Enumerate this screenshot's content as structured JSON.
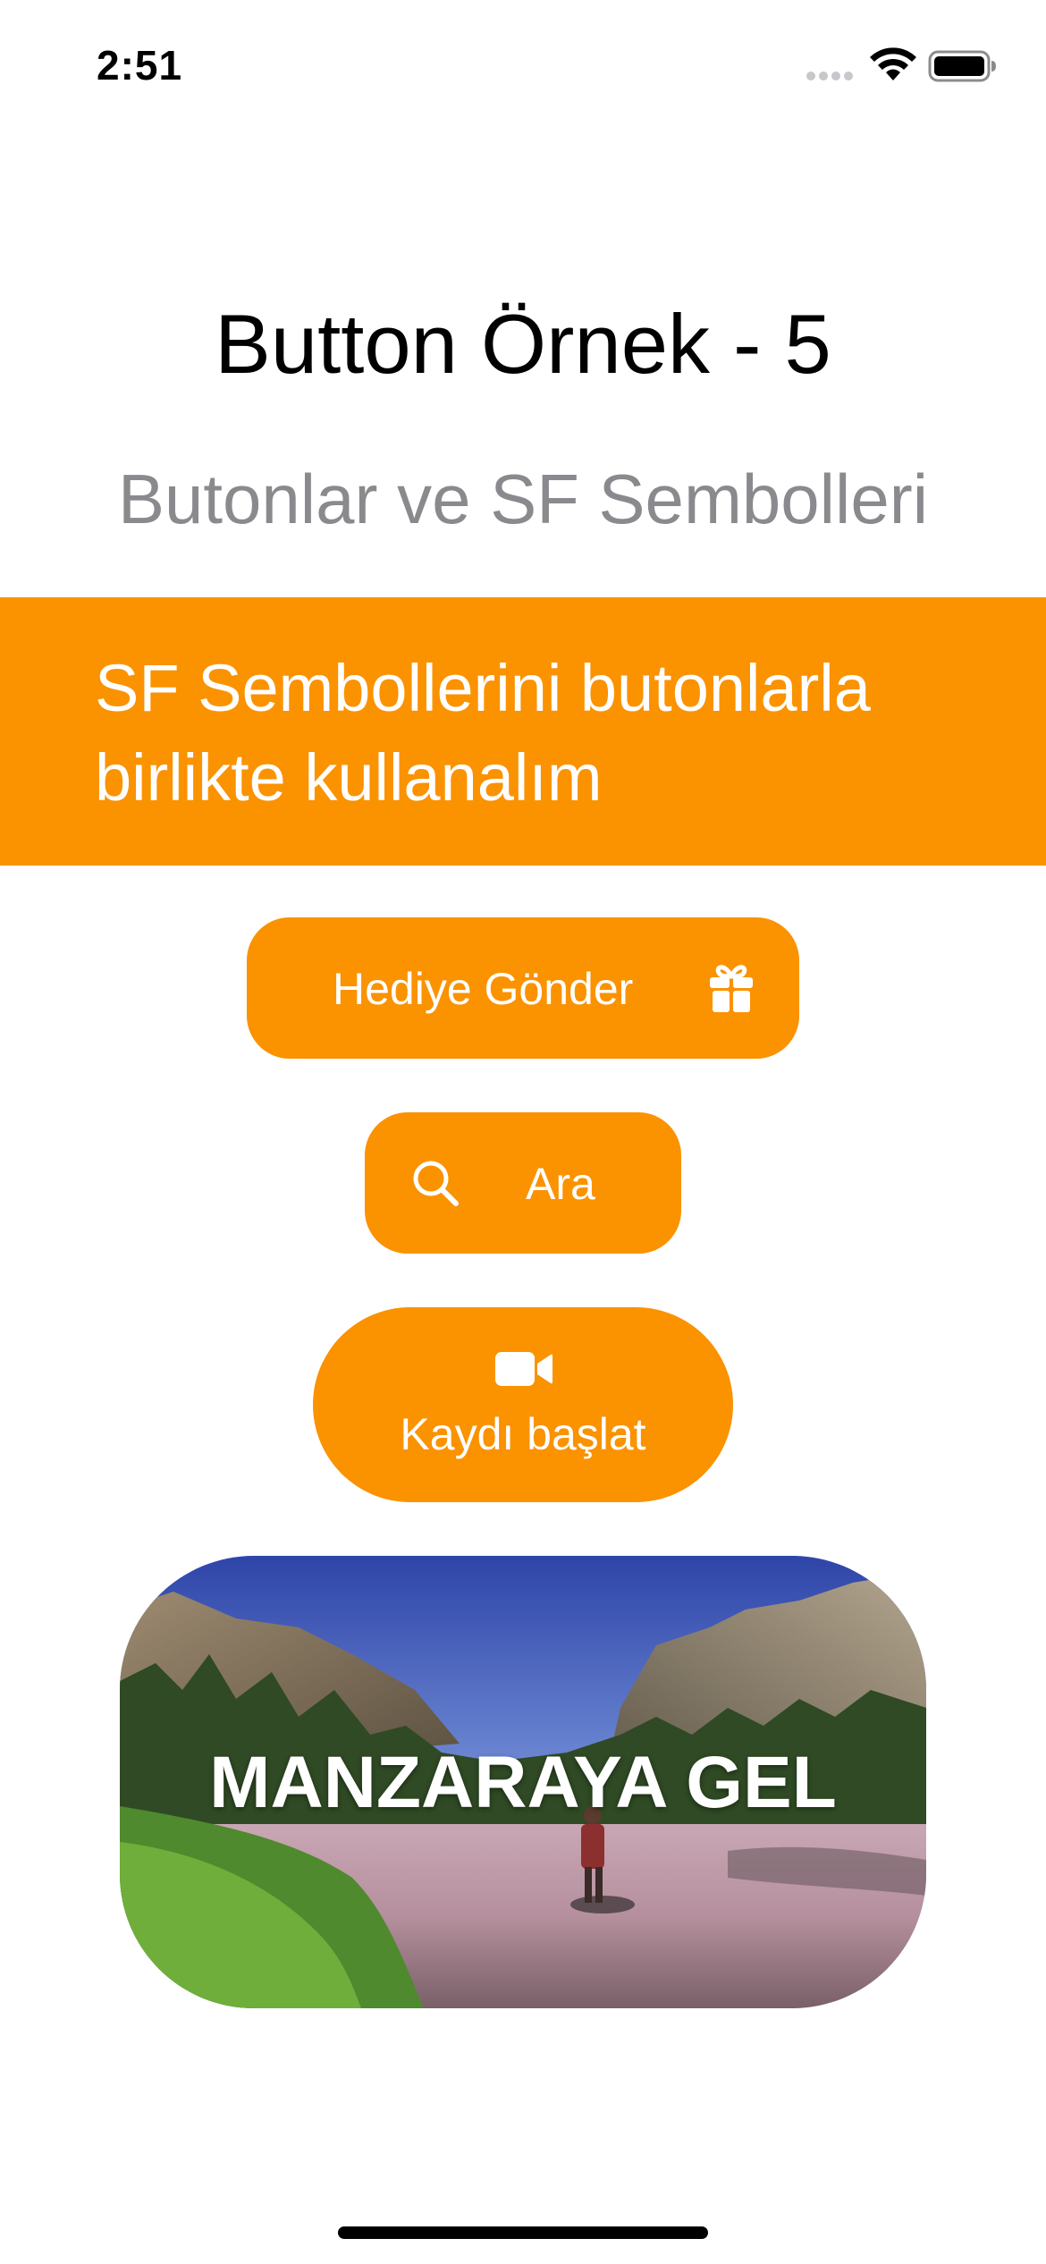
{
  "status_bar": {
    "time": "2:51"
  },
  "header": {
    "title": "Button Örnek - 5",
    "subtitle": "Butonlar ve SF Sembolleri"
  },
  "banner": {
    "text": "SF Sembollerini butonlarla birlikte kullanalım",
    "background": "#fb9200"
  },
  "buttons": {
    "gift": {
      "label": "Hediye Gönder",
      "icon": "gift-icon"
    },
    "search": {
      "label": "Ara",
      "icon": "magnifying-glass-icon"
    },
    "record": {
      "label": "Kaydı başlat",
      "icon": "video-camera-icon"
    },
    "landscape": {
      "label": "MANZARAYA GEL"
    }
  },
  "colors": {
    "accent": "#fb9200",
    "subtitle": "#8a8a8e",
    "on_accent": "#ffffff"
  }
}
